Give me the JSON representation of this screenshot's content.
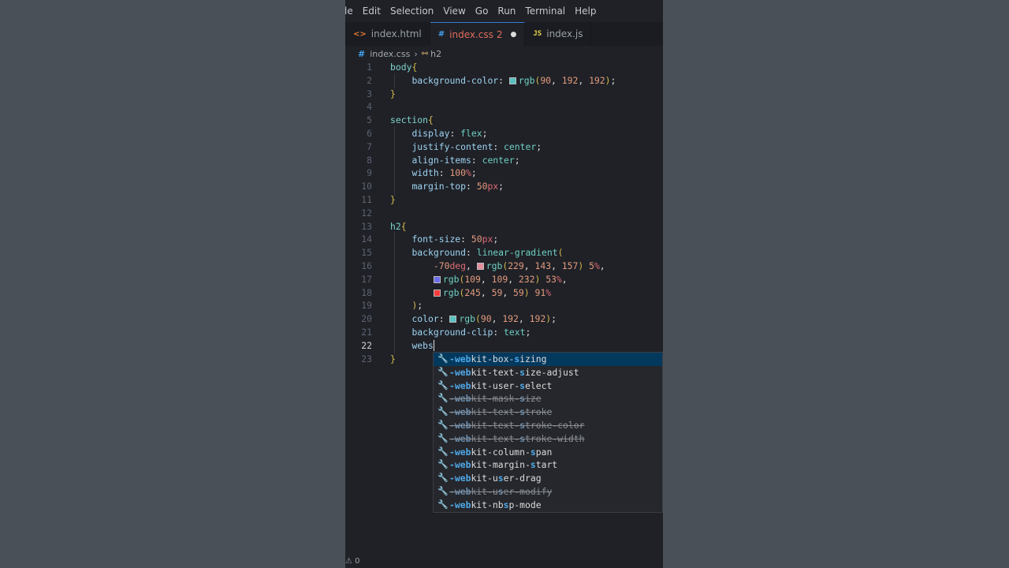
{
  "menu": [
    "le",
    "Edit",
    "Selection",
    "View",
    "Go",
    "Run",
    "Terminal",
    "Help"
  ],
  "tabs": [
    {
      "label": "index.html",
      "icon": "html-file-icon",
      "active": false
    },
    {
      "label": "index.css",
      "icon": "css-file-icon",
      "active": true,
      "badge": "2",
      "dirty": true
    },
    {
      "label": "index.js",
      "icon": "js-file-icon",
      "active": false
    }
  ],
  "breadcrumb": {
    "file": "index.css",
    "symbol": "h2"
  },
  "code_lines": [
    {
      "n": "1",
      "html": "<span class='sel'>body</span><span class='brace'>{</span>"
    },
    {
      "n": "2",
      "html": "    <span class='prop'>background-color</span>: <span class='swatch' style='background:rgb(90,192,192)'></span><span class='val'>rgb</span><span class='paren'>(</span><span class='num'>90</span>, <span class='num'>192</span>, <span class='num'>192</span><span class='paren'>)</span>;"
    },
    {
      "n": "3",
      "html": "<span class='brace'>}</span>"
    },
    {
      "n": "4",
      "html": ""
    },
    {
      "n": "5",
      "html": "<span class='sel'>section</span><span class='brace'>{</span>"
    },
    {
      "n": "6",
      "html": "    <span class='prop'>display</span>: <span class='val'>flex</span>;"
    },
    {
      "n": "7",
      "html": "    <span class='prop'>justify-content</span>: <span class='val'>center</span>;"
    },
    {
      "n": "8",
      "html": "    <span class='prop'>align-items</span>: <span class='val'>center</span>;"
    },
    {
      "n": "9",
      "html": "    <span class='prop'>width</span>: <span class='num'>100</span><span class='pct'>%</span>;"
    },
    {
      "n": "10",
      "html": "    <span class='prop'>margin-top</span>: <span class='num'>50</span><span class='unit'>px</span>;"
    },
    {
      "n": "11",
      "html": "<span class='brace'>}</span>"
    },
    {
      "n": "12",
      "html": ""
    },
    {
      "n": "13",
      "html": "<span class='sel'>h2</span><span class='brace'>{</span>"
    },
    {
      "n": "14",
      "html": "    <span class='prop'>font-size</span>: <span class='num'>50</span><span class='unit'>px</span>;"
    },
    {
      "n": "15",
      "html": "    <span class='prop'>background</span>: <span class='val'>linear-gradient</span><span class='paren'>(</span>"
    },
    {
      "n": "16",
      "html": "        <span class='num'>-70</span><span class='unit'>deg</span>, <span class='swatch' style='background:rgb(229,143,157)'></span><span class='val'>rgb</span><span class='paren'>(</span><span class='num'>229</span>, <span class='num'>143</span>, <span class='num'>157</span><span class='paren'>)</span> <span class='num'>5</span><span class='pct'>%</span>,"
    },
    {
      "n": "17",
      "html": "        <span class='swatch' style='background:rgb(109,109,232)'></span><span class='val'>rgb</span><span class='paren'>(</span><span class='num'>109</span>, <span class='num'>109</span>, <span class='num'>232</span><span class='paren'>)</span> <span class='num'>53</span><span class='pct'>%</span>,"
    },
    {
      "n": "18",
      "html": "        <span class='swatch' style='background:rgb(245,59,59)'></span><span class='val'>rgb</span><span class='paren'>(</span><span class='num'>245</span>, <span class='num'>59</span>, <span class='num'>59</span><span class='paren'>)</span> <span class='num'>91</span><span class='pct'>%</span>"
    },
    {
      "n": "19",
      "html": "    <span class='paren'>)</span>;"
    },
    {
      "n": "20",
      "html": "    <span class='prop'>color</span>: <span class='swatch' style='background:rgb(90,192,192)'></span><span class='val'>rgb</span><span class='paren'>(</span><span class='num'>90</span>, <span class='num'>192</span>, <span class='num'>192</span><span class='paren'>)</span>;"
    },
    {
      "n": "21",
      "html": "    <span class='prop'>background-clip</span>: <span class='val'>text</span>;"
    },
    {
      "n": "22",
      "html": "    <span class='prop'>webs</span><span class='cursor'></span>",
      "current": true
    },
    {
      "n": "23",
      "html": "<span class='brace'>}</span>"
    }
  ],
  "suggestions": [
    {
      "match1": "-web",
      "rest1": "kit-box-",
      "match2": "s",
      "rest2": "izing",
      "deprecated": false,
      "selected": true
    },
    {
      "match1": "-web",
      "rest1": "kit-text-",
      "match2": "s",
      "rest2": "ize-adjust",
      "deprecated": false
    },
    {
      "match1": "-web",
      "rest1": "kit-user-",
      "match2": "s",
      "rest2": "elect",
      "deprecated": false
    },
    {
      "match1": "-web",
      "rest1": "kit-mask-",
      "match2": "s",
      "rest2": "ize",
      "deprecated": true
    },
    {
      "match1": "-web",
      "rest1": "kit-text-",
      "match2": "s",
      "rest2": "troke",
      "deprecated": true
    },
    {
      "match1": "-web",
      "rest1": "kit-text-",
      "match2": "s",
      "rest2": "troke-color",
      "deprecated": true
    },
    {
      "match1": "-web",
      "rest1": "kit-text-",
      "match2": "s",
      "rest2": "troke-width",
      "deprecated": true
    },
    {
      "match1": "-web",
      "rest1": "kit-column-",
      "match2": "s",
      "rest2": "pan",
      "deprecated": false
    },
    {
      "match1": "-web",
      "rest1": "kit-margin-",
      "match2": "s",
      "rest2": "tart",
      "deprecated": false
    },
    {
      "match1": "-web",
      "rest1": "kit-u",
      "match2": "s",
      "rest2": "er-drag",
      "deprecated": false
    },
    {
      "match1": "-web",
      "rest1": "kit-u",
      "match2": "s",
      "rest2": "er-modify",
      "deprecated": true
    },
    {
      "match1": "-web",
      "rest1": "kit-nb",
      "match2": "s",
      "rest2": "p-mode",
      "deprecated": false
    }
  ],
  "status": {
    "problems": "⚠ 0"
  }
}
